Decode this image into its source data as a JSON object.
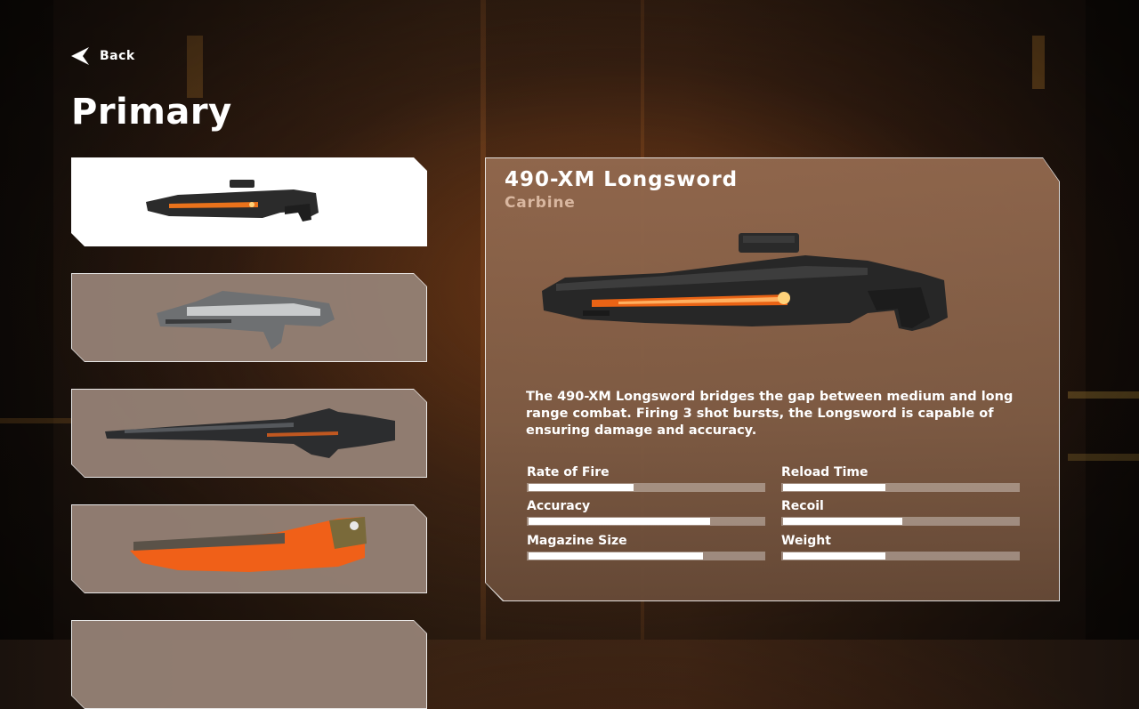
{
  "nav": {
    "back_label": "Back",
    "back_icon": "back-arrow-icon"
  },
  "page": {
    "title": "Primary"
  },
  "weapons": [
    {
      "id": "longsword",
      "image": "orange-carbine-rifle",
      "selected": true
    },
    {
      "id": "rifle-2",
      "image": "grey-assault-rifle",
      "selected": false
    },
    {
      "id": "rifle-3",
      "image": "long-sniper-rifle",
      "selected": false
    },
    {
      "id": "rifle-4",
      "image": "orange-spiked-launcher",
      "selected": false
    },
    {
      "id": "rifle-5",
      "image": "partially-visible-weapon",
      "selected": false
    }
  ],
  "detail": {
    "name": "490-XM Longsword",
    "class": "Carbine",
    "description": "The 490-XM Longsword bridges the gap between medium and long range combat. Firing 3 shot bursts, the Longsword is capable of ensuring damage and accuracy.",
    "stats": [
      {
        "label": "Rate of Fire",
        "value": 0.44
      },
      {
        "label": "Reload Time",
        "value": 0.43
      },
      {
        "label": "Accuracy",
        "value": 0.76
      },
      {
        "label": "Recoil",
        "value": 0.5
      },
      {
        "label": "Magazine Size",
        "value": 0.73
      },
      {
        "label": "Weight",
        "value": 0.43
      }
    ]
  },
  "colors": {
    "accent": "#ff7a1a",
    "panel": "#6e3714",
    "text_secondary": "#d9b7a0"
  }
}
